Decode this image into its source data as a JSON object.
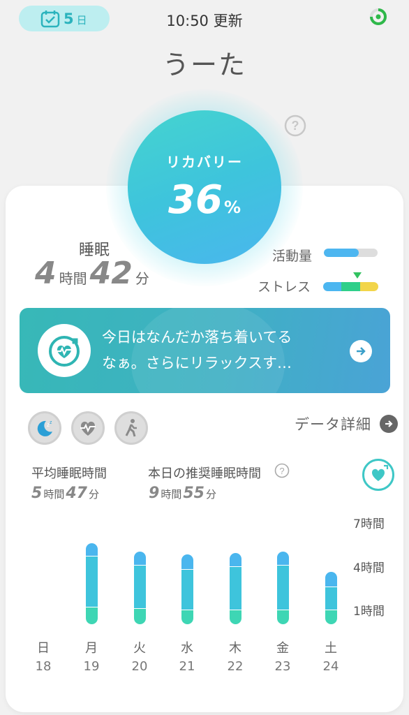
{
  "header": {
    "streak_count": "5",
    "streak_unit": "日",
    "update_time": "10:50 更新",
    "user_name": "うーた"
  },
  "recovery": {
    "label": "リカバリー",
    "value": "36",
    "unit": "%"
  },
  "sleep": {
    "label": "睡眠",
    "hours": "4",
    "hours_unit": "時間",
    "minutes": "42",
    "minutes_unit": "分"
  },
  "activity": {
    "label": "活動量",
    "level": 0.65
  },
  "stress": {
    "label": "ストレス",
    "colors": [
      "#4cb6f0",
      "#2fcf8a",
      "#f2d54a"
    ],
    "level": 0.5
  },
  "banner": {
    "line1": "今日はなんだか落ち着いてる",
    "line2": "なぁ。さらにリラックスす…"
  },
  "tabs": [
    "sleep",
    "heart",
    "walk"
  ],
  "data_detail_label": "データ詳細",
  "average": {
    "label": "平均睡眠時間",
    "hours": "5",
    "hours_unit": "時間",
    "minutes": "47",
    "minutes_unit": "分"
  },
  "recommended": {
    "label": "本日の推奨睡眠時間",
    "hours": "9",
    "hours_unit": "時間",
    "minutes": "55",
    "minutes_unit": "分"
  },
  "colors": {
    "accent": "#3ec7c6",
    "bar_top": "#4ab6ee",
    "bar_mid": "#3ec4dc",
    "bar_bottom": "#3ed6b4"
  },
  "chart_data": {
    "type": "bar",
    "stacked": true,
    "categories": [
      "日",
      "月",
      "火",
      "水",
      "木",
      "金",
      "土"
    ],
    "dates": [
      "18",
      "19",
      "20",
      "21",
      "22",
      "23",
      "24"
    ],
    "y_ticks": [
      "7時間",
      "4時間",
      "1時間"
    ],
    "y_tick_values": [
      7,
      4,
      1
    ],
    "ylim": [
      0,
      8
    ],
    "series": [
      {
        "values": [
          0,
          1.2,
          1.1,
          1.0,
          1.0,
          1.0,
          1.0
        ]
      },
      {
        "values": [
          0,
          3.5,
          3.0,
          2.8,
          3.0,
          3.1,
          1.6
        ]
      },
      {
        "values": [
          0,
          0.9,
          0.9,
          1.0,
          0.9,
          0.9,
          1.0
        ]
      }
    ]
  }
}
